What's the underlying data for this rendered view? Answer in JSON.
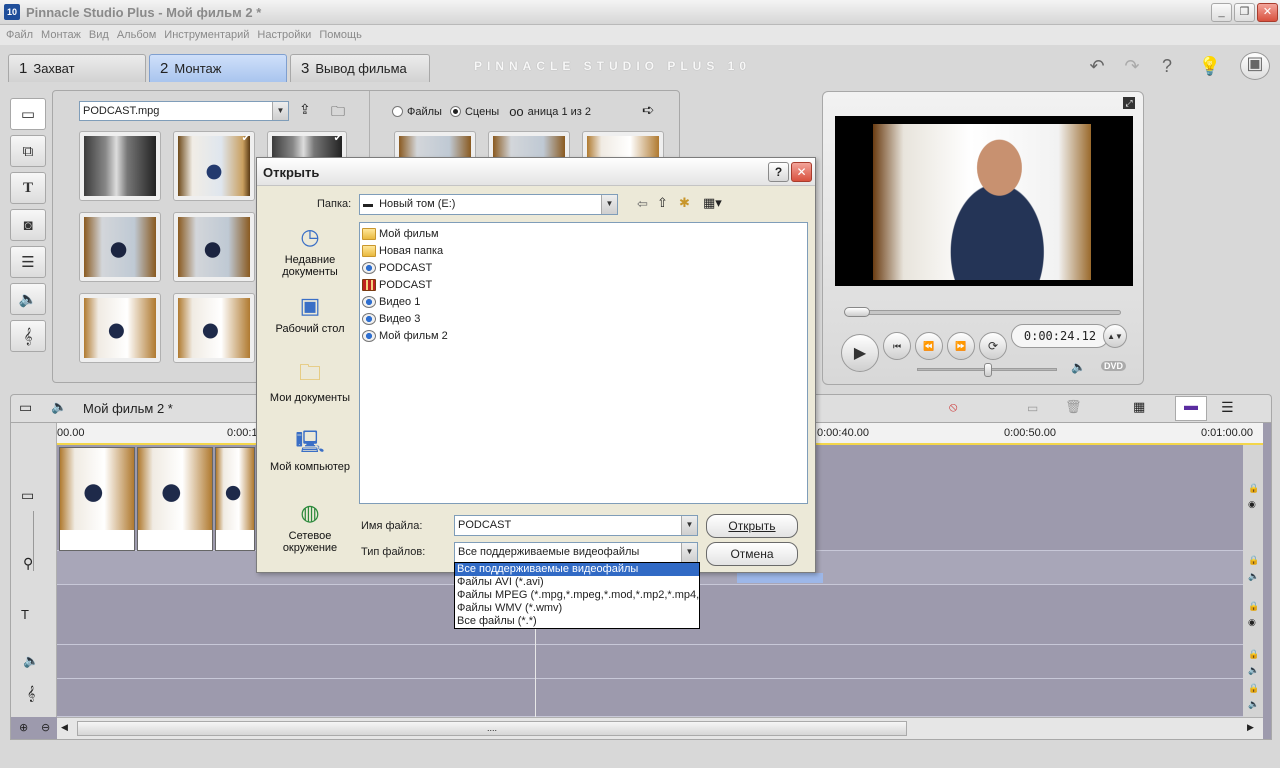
{
  "app": {
    "title": "Pinnacle Studio Plus - Мой фильм 2 *",
    "icon_text": "10",
    "brand": "PINNACLE STUDIO PLUS 10"
  },
  "menu": [
    "Файл",
    "Монтаж",
    "Вид",
    "Альбом",
    "Инструментарий",
    "Настройки",
    "Помощь"
  ],
  "tabs": [
    {
      "num": "1",
      "label": "Захват"
    },
    {
      "num": "2",
      "label": "Монтаж"
    },
    {
      "num": "3",
      "label": "Вывод фильма"
    }
  ],
  "album": {
    "file_combo": "PODCAST.mpg",
    "radio_files": "Файлы",
    "radio_scenes": "Сцены",
    "page_label": "аница 1 из 2"
  },
  "player": {
    "timecode": "0:00:24.12",
    "dvd_label": "DVD"
  },
  "timeline": {
    "title": "Мой фильм 2 *",
    "ticks": [
      "00.00",
      "0:00:1",
      "0:00:40.00",
      "0:00:50.00",
      "0:01:00.00"
    ],
    "scroll_grip": "...."
  },
  "dialog": {
    "title": "Открыть",
    "help_btn": "?",
    "close_btn": "✕",
    "folder_label": "Папка:",
    "folder_value": "Новый том (E:)",
    "places": [
      {
        "label": "Недавние документы"
      },
      {
        "label": "Рабочий стол"
      },
      {
        "label": "Мои документы"
      },
      {
        "label": "Мой компьютер"
      },
      {
        "label": "Сетевое окружение"
      }
    ],
    "files": [
      {
        "name": "Мой фильм",
        "kind": "folder"
      },
      {
        "name": "Новая папка",
        "kind": "folder"
      },
      {
        "name": "PODCAST",
        "kind": "media"
      },
      {
        "name": "PODCAST",
        "kind": "film"
      },
      {
        "name": "Видео 1",
        "kind": "media"
      },
      {
        "name": "Видео 3",
        "kind": "media"
      },
      {
        "name": "Мой фильм 2",
        "kind": "media"
      }
    ],
    "filename_label": "Имя файла:",
    "filename_value": "PODCAST",
    "filetype_label": "Тип файлов:",
    "filetype_value": "Все поддерживаемые видеофайлы",
    "open_btn": "Открыть",
    "cancel_btn": "Отмена",
    "filetype_options": [
      "Все поддерживаемые видеофайлы",
      "Файлы AVI (*.avi)",
      "Файлы MPEG (*.mpg,*.mpeg,*.mod,*.mp2,*.mp4,*.m",
      "Файлы WMV (*.wmv)",
      "Все файлы (*.*)"
    ]
  }
}
